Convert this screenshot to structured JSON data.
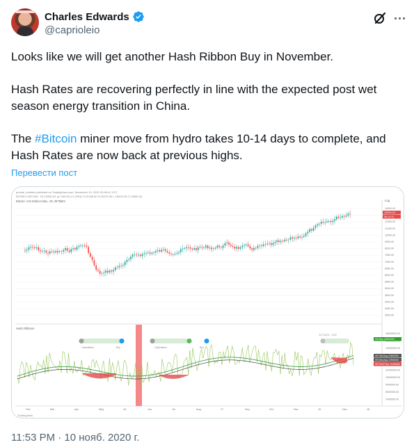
{
  "author": {
    "display_name": "Charles Edwards",
    "handle": "@caprioleio",
    "verified": true
  },
  "header_icons": [
    "grok-icon",
    "more-options-icon"
  ],
  "tweet": {
    "line1": "Looks like we will get another Hash Ribbon Buy in November.",
    "line2": "Hash Rates are recovering perfectly in line with the expected post wet season energy transition in China.",
    "line3_prefix": "The ",
    "hashtag": "#Bitcoin",
    "line3_suffix": " miner move from hydro takes 10-14 days to complete, and Hash Rates are now back at previous highs.",
    "translate_label": "Перевести пост"
  },
  "chart": {
    "header_text": "private_charles published on TradingView.com, November 10, 2020 20:49:41 UTC",
    "symbol_line": "BITMEX:XBTUSD, 1D  15350.00  ▲+165.50 (+1.09%)  O:15185.50  H:15470.00  L:15000.00  C:15350.00",
    "pane_title": "Bitcoin / US Dollar Index, 1D, BITMEX",
    "indicator_title": "Hash Ribbons",
    "log_label": "Log",
    "price_badges": [
      "15350.00",
      "06:10:11"
    ],
    "price_ticks": [
      "14000.00",
      "13000.00",
      "12000.00",
      "11000.00",
      "10000.00",
      "9000.00",
      "8000.00",
      "7500.00",
      "7000.00",
      "6500.00",
      "6000.00",
      "5500.00",
      "5000.00",
      "4500.00",
      "4000.00",
      "3500.00",
      "3000.00"
    ],
    "indicator_badges": [
      {
        "label": "HR Buy",
        "value": "14500000",
        "color": "#2ca02c"
      },
      {
        "label": "HR 30d Avg",
        "value": "13500000",
        "color": "#555555"
      },
      {
        "label": "HR 60d Avg",
        "value": "12900000",
        "color": "#555555"
      },
      {
        "label": "HR Sell Price",
        "value": "12400000",
        "color": "#e64a4a"
      }
    ],
    "indicator_ticks": [
      "16000000.00",
      "15000000.00",
      "14000000.00",
      "13000000.00",
      "12000000.00",
      "11000000.00",
      "10000000.00",
      "9000000.00",
      "8000000.00",
      "7000000.00"
    ],
    "annotation": "14 bars, 14d",
    "capitulation_labels": [
      "Capitulation",
      "Buy",
      "Capitulation",
      "Buy"
    ],
    "x_labels": [
      "Feb",
      "Mar",
      "Apr",
      "May",
      "16",
      "Jun",
      "Jul",
      "Aug",
      "17",
      "Sep",
      "Oct",
      "Nov",
      "16",
      "Dec",
      "16"
    ],
    "footer": "TradingView"
  },
  "timestamp": "11:53 PM · 10 нояб. 2020 г.",
  "colors": {
    "accent": "#1d9bf0",
    "candle_up": "#26a69a",
    "candle_down": "#ef5350",
    "ribbon_sell": "#e64a4a",
    "ribbon_buy": "#2ca02c"
  }
}
